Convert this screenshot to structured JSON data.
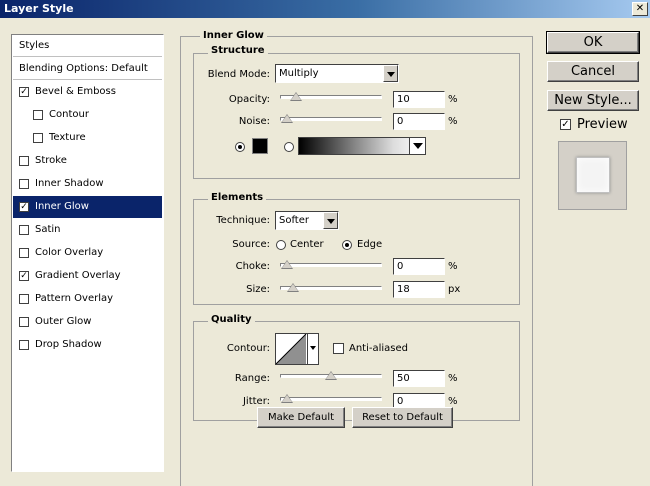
{
  "window": {
    "title": "Layer Style",
    "close_glyph": "✕"
  },
  "styles_list": {
    "header": "Styles",
    "blending": "Blending Options: Default",
    "items": [
      {
        "label": "Bevel & Emboss",
        "checked": true
      },
      {
        "label": "Contour",
        "checked": false
      },
      {
        "label": "Texture",
        "checked": false
      },
      {
        "label": "Stroke",
        "checked": false
      },
      {
        "label": "Inner Shadow",
        "checked": false
      },
      {
        "label": "Inner Glow",
        "checked": true,
        "selected": true
      },
      {
        "label": "Satin",
        "checked": false
      },
      {
        "label": "Color Overlay",
        "checked": false
      },
      {
        "label": "Gradient Overlay",
        "checked": true
      },
      {
        "label": "Pattern Overlay",
        "checked": false
      },
      {
        "label": "Outer Glow",
        "checked": false
      },
      {
        "label": "Drop Shadow",
        "checked": false
      }
    ]
  },
  "inner_glow": {
    "title": "Inner Glow",
    "structure": {
      "title": "Structure",
      "blend_mode_label": "Blend Mode:",
      "blend_mode_value": "Multiply",
      "opacity_label": "Opacity:",
      "opacity_value": "10",
      "noise_label": "Noise:",
      "noise_value": "0",
      "percent": "%",
      "color_swatch": "#000000"
    },
    "elements": {
      "title": "Elements",
      "technique_label": "Technique:",
      "technique_value": "Softer",
      "source_label": "Source:",
      "source_center": "Center",
      "source_edge": "Edge",
      "choke_label": "Choke:",
      "choke_value": "0",
      "size_label": "Size:",
      "size_value": "18",
      "px": "px",
      "percent": "%"
    },
    "quality": {
      "title": "Quality",
      "contour_label": "Contour:",
      "anti_aliased": "Anti-aliased",
      "range_label": "Range:",
      "range_value": "50",
      "jitter_label": "Jitter:",
      "jitter_value": "0",
      "percent": "%"
    },
    "make_default": "Make Default",
    "reset_default": "Reset to Default"
  },
  "buttons": {
    "ok": "OK",
    "cancel": "Cancel",
    "new_style": "New Style...",
    "preview_label": "Preview"
  },
  "slider_levels": {
    "opacity": 0.1,
    "noise": 0.0,
    "choke": 0.0,
    "size": 0.07,
    "range": 0.5,
    "jitter": 0.0
  }
}
